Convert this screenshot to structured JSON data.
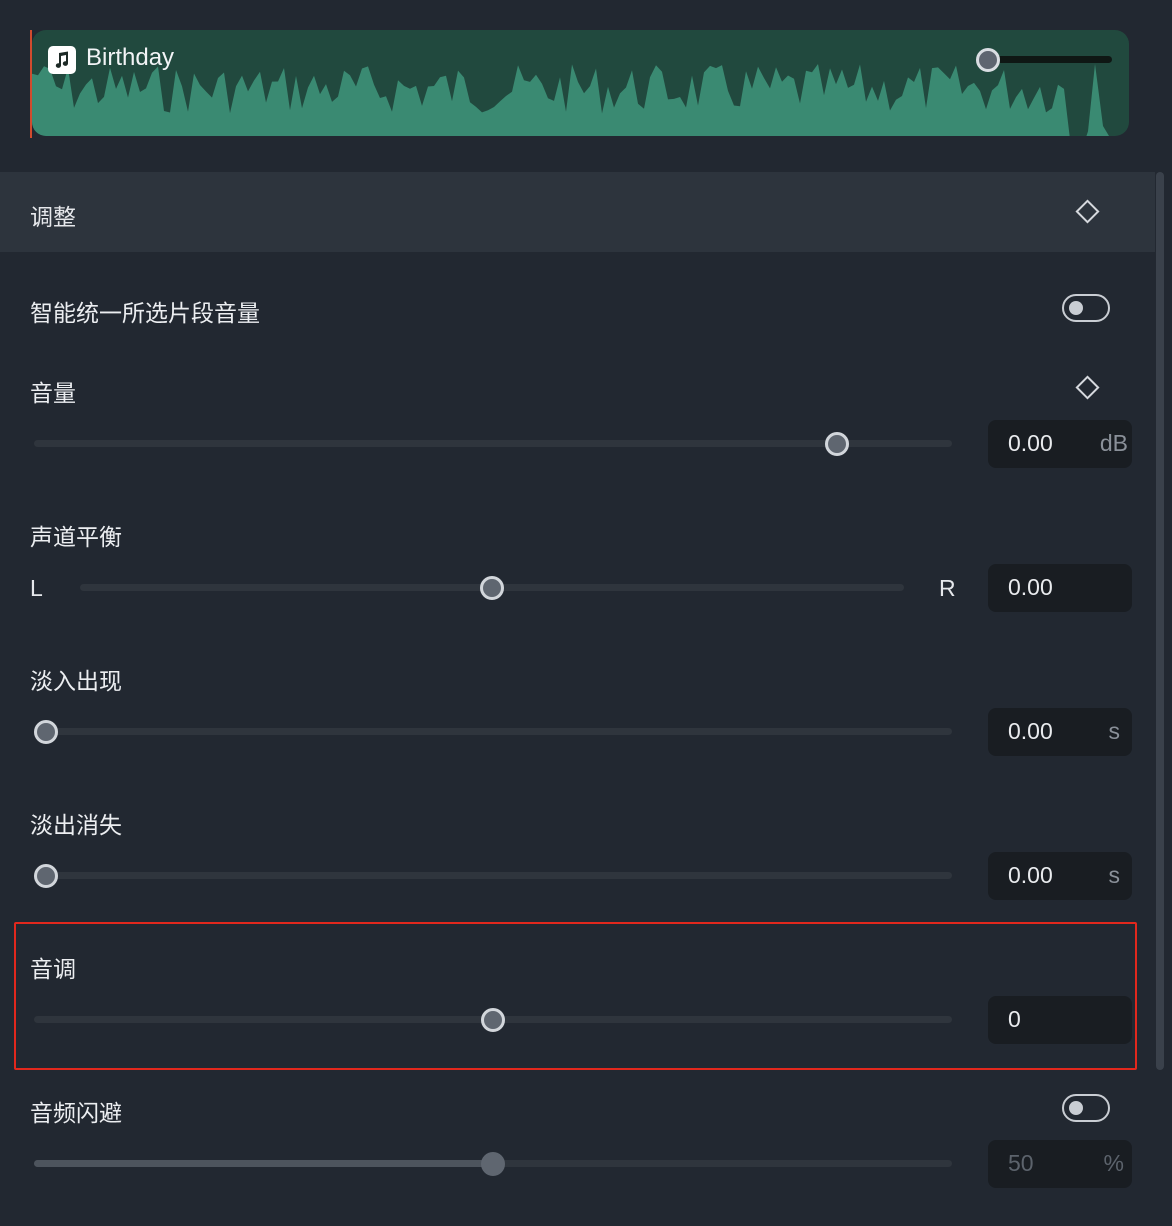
{
  "clip": {
    "name": "Birthday",
    "icon": "music-note-icon",
    "volume_fraction": 0.0
  },
  "section": {
    "title": "调整",
    "keyframe_icon": "keyframe-diamond-icon"
  },
  "smart_volume": {
    "label": "智能统一所选片段音量",
    "enabled": false
  },
  "volume": {
    "label": "音量",
    "value": "0.00",
    "unit": "dB",
    "fraction": 0.885
  },
  "balance": {
    "label": "声道平衡",
    "left": "L",
    "right": "R",
    "value": "0.00",
    "fraction": 0.5
  },
  "fade_in": {
    "label": "淡入出现",
    "value": "0.00",
    "unit": "s",
    "fraction": 0.0
  },
  "fade_out": {
    "label": "淡出消失",
    "value": "0.00",
    "unit": "s",
    "fraction": 0.0
  },
  "pitch": {
    "label": "音调",
    "value": "0",
    "fraction": 0.5
  },
  "ducking": {
    "label": "音频闪避",
    "enabled": false,
    "value": "50",
    "unit": "%",
    "fraction": 0.5
  },
  "colors": {
    "accent_highlight": "#e2281d",
    "waveform": "#3a8a72",
    "clip_bg": "#21493e"
  }
}
